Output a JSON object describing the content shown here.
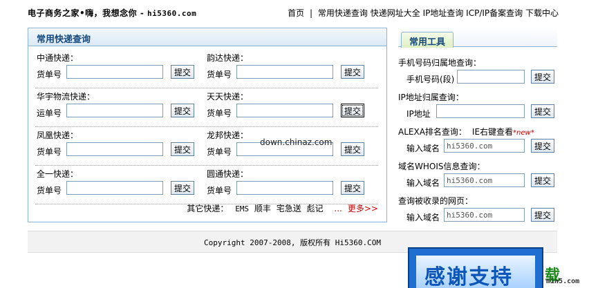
{
  "site": {
    "title": "电子商务之家",
    "tagline": "•嗨，我想念你 - ",
    "domain": "hi5360.com"
  },
  "nav": {
    "items": [
      "首页",
      "常用快递查询",
      "快递网址大全",
      "IP地址查询",
      "ICP/IP备案查询",
      "下载中心"
    ],
    "separator": "|"
  },
  "express_panel": {
    "title": "常用快递查询",
    "submit_label": "提交",
    "rows": [
      [
        {
          "name": "中通快递：",
          "label": "货单号",
          "value": ""
        },
        {
          "name": "韵达快递：",
          "label": "货单号",
          "value": ""
        }
      ],
      [
        {
          "name": "华宇物流快递：",
          "label": "运单号",
          "value": ""
        },
        {
          "name": "天天快递：",
          "label": "货单号",
          "value": ""
        }
      ],
      [
        {
          "name": "凤凰快递：",
          "label": "货单号",
          "value": ""
        },
        {
          "name": "龙邦快递：",
          "label": "货单号",
          "value": ""
        }
      ],
      [
        {
          "name": "全一快递：",
          "label": "货单号",
          "value": ""
        },
        {
          "name": "圆通快递：",
          "label": "货单号",
          "value": ""
        }
      ]
    ],
    "others": {
      "label": "其它快递：",
      "items": [
        "EMS",
        "顺丰",
        "宅急送",
        "彪记"
      ],
      "ellipsis": "...",
      "more": "更多>>"
    }
  },
  "tools_panel": {
    "tab": "常用工具",
    "submit_label": "提交",
    "tools": [
      {
        "title": "手机号码归属地查询：",
        "label": "手机号码(段)",
        "value": ""
      },
      {
        "title": "IP地址归属查询：",
        "label": "IP地址",
        "value": ""
      },
      {
        "title": "ALEXA排名查询：",
        "note": "IE右键查看",
        "badge": "*new*",
        "label": "输入域名",
        "value": "hi5360.com"
      },
      {
        "title": "域名WHOIS信息查询：",
        "label": "输入域名",
        "value": "hi5360.com"
      },
      {
        "title": "查询被收录的网页：",
        "label": "输入域名",
        "value": "hi5360.com"
      }
    ]
  },
  "footer": {
    "copyright": "Copyright 2007-2008, 版权所有 Hi5360.COM"
  },
  "watermark": {
    "text": "down.chinaz.com"
  },
  "overlay": {
    "banner": "感谢支持",
    "corner_a": "载",
    "corner_b": "min5.com"
  }
}
